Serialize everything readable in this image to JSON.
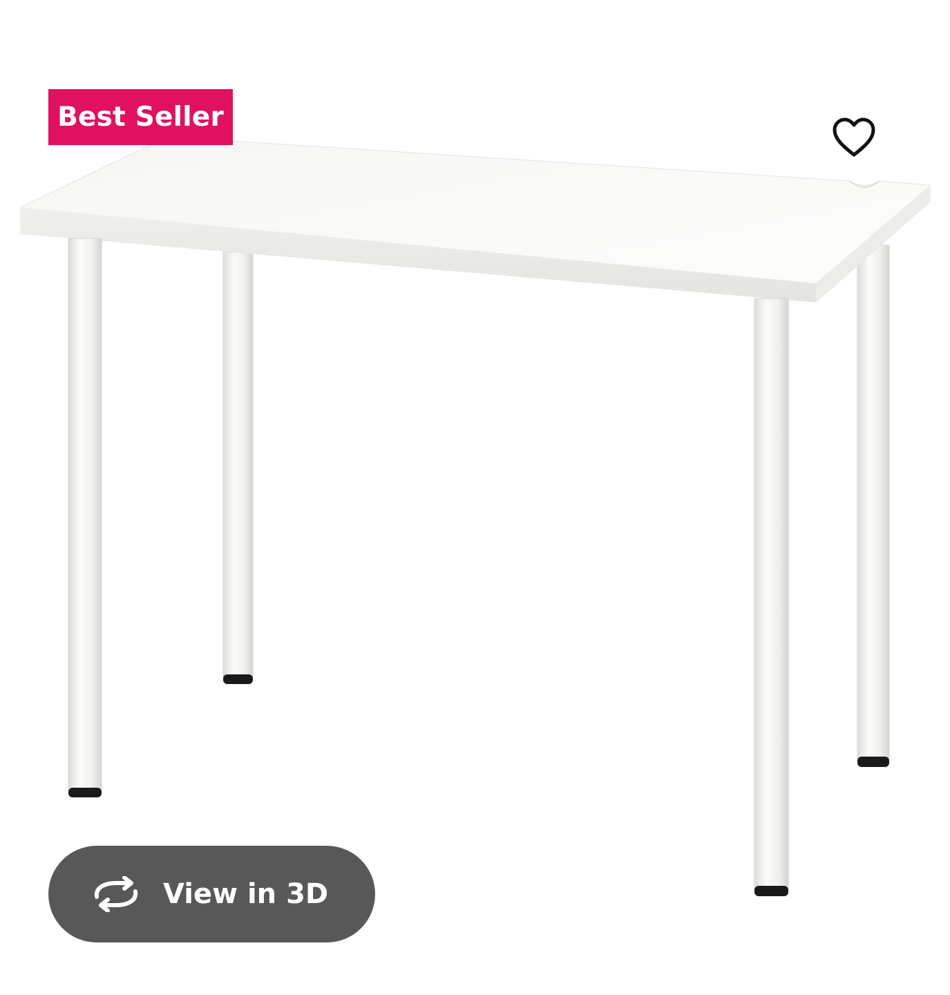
{
  "product": {
    "image_subject": "desk",
    "badge_label": "Best Seller",
    "badge_color": "#e0115f",
    "favorite_icon": "heart-outline-icon",
    "view3d_label": "View in 3D",
    "view3d_icon": "rotate-arrows-icon",
    "view3d_bg": "#585858"
  }
}
